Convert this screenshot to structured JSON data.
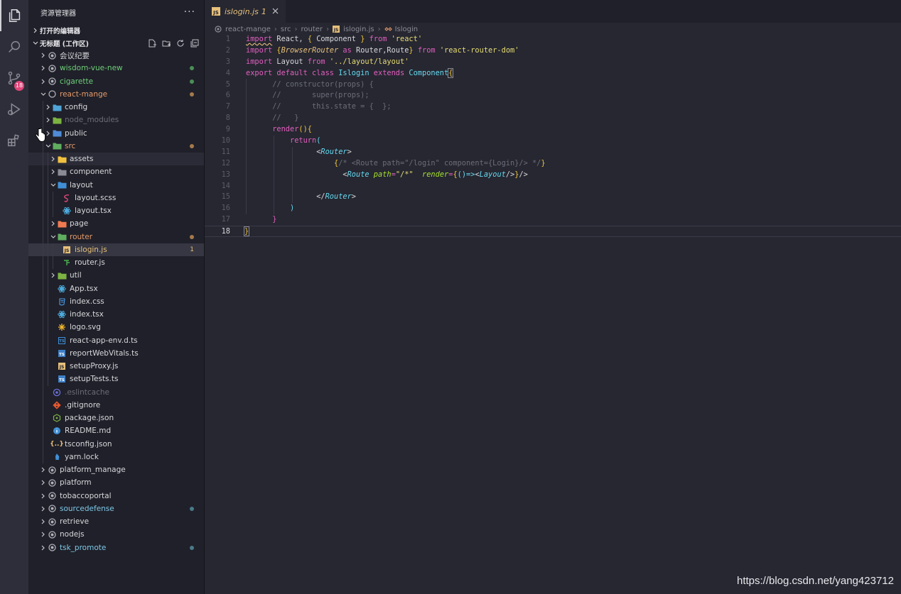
{
  "sidebar": {
    "title": "资源管理器",
    "more": "···",
    "open_editors": "打开的编辑器",
    "workspace": "无标题 (工作区)"
  },
  "activity": {
    "scm_badge": "18"
  },
  "tree": [
    {
      "label": "会议纪要",
      "indent": 0,
      "chev": ">",
      "icon": "folder-root-icon",
      "color": "#d8d8dc"
    },
    {
      "label": "wisdom-vue-new",
      "indent": 0,
      "chev": ">",
      "icon": "folder-root-icon",
      "color": "#6fce7a",
      "dot": "#4a8f57"
    },
    {
      "label": "cigarette",
      "indent": 0,
      "chev": ">",
      "icon": "folder-root-icon",
      "color": "#6fce7a",
      "dot": "#4a8f57"
    },
    {
      "label": "react-mange",
      "indent": 0,
      "chev": "v",
      "icon": "folder-root-open-icon",
      "color": "#e59a6a",
      "dot": "#a57a4a"
    },
    {
      "label": "config",
      "indent": 1,
      "chev": ">",
      "icon": "folder-config-icon",
      "color": "#d8d8dc"
    },
    {
      "label": "node_modules",
      "indent": 1,
      "chev": ">",
      "icon": "folder-node-icon",
      "color": "#6c6d78"
    },
    {
      "label": "public",
      "indent": 1,
      "chev": ">",
      "icon": "folder-public-icon",
      "color": "#d8d8dc"
    },
    {
      "label": "src",
      "indent": 1,
      "chev": "v",
      "icon": "folder-src-icon",
      "color": "#e59a6a",
      "dot": "#a57a4a"
    },
    {
      "label": "assets",
      "indent": 2,
      "chev": ">",
      "icon": "folder-assets-icon",
      "color": "#d8d8dc",
      "hl": true
    },
    {
      "label": "component",
      "indent": 2,
      "chev": ">",
      "icon": "folder-icon",
      "color": "#d8d8dc"
    },
    {
      "label": "layout",
      "indent": 2,
      "chev": "v",
      "icon": "folder-layout-icon",
      "color": "#d8d8dc"
    },
    {
      "label": "layout.scss",
      "indent": 3,
      "chev": "",
      "icon": "sass-icon",
      "color": "#d8d8dc"
    },
    {
      "label": "layout.tsx",
      "indent": 3,
      "chev": "",
      "icon": "react-icon",
      "color": "#d8d8dc"
    },
    {
      "label": "page",
      "indent": 2,
      "chev": ">",
      "icon": "folder-page-icon",
      "color": "#d8d8dc"
    },
    {
      "label": "router",
      "indent": 2,
      "chev": "v",
      "icon": "folder-router-icon",
      "color": "#e59a6a",
      "dot": "#a57a4a"
    },
    {
      "label": "islogin.js",
      "indent": 3,
      "chev": "",
      "icon": "js-icon",
      "color": "#e7c07b",
      "num": "1",
      "selected": true
    },
    {
      "label": "router.js",
      "indent": 3,
      "chev": "",
      "icon": "routing-icon",
      "color": "#d8d8dc"
    },
    {
      "label": "util",
      "indent": 2,
      "chev": ">",
      "icon": "folder-util-icon",
      "color": "#d8d8dc"
    },
    {
      "label": "App.tsx",
      "indent": 2,
      "chev": "",
      "icon": "react-icon",
      "color": "#d8d8dc"
    },
    {
      "label": "index.css",
      "indent": 2,
      "chev": "",
      "icon": "css-icon",
      "color": "#d8d8dc"
    },
    {
      "label": "index.tsx",
      "indent": 2,
      "chev": "",
      "icon": "react-icon",
      "color": "#d8d8dc"
    },
    {
      "label": "logo.svg",
      "indent": 2,
      "chev": "",
      "icon": "svg-icon",
      "color": "#d8d8dc"
    },
    {
      "label": "react-app-env.d.ts",
      "indent": 2,
      "chev": "",
      "icon": "ts-def-icon",
      "color": "#d8d8dc"
    },
    {
      "label": "reportWebVitals.ts",
      "indent": 2,
      "chev": "",
      "icon": "ts-icon",
      "color": "#d8d8dc"
    },
    {
      "label": "setupProxy.js",
      "indent": 2,
      "chev": "",
      "icon": "js-icon",
      "color": "#d8d8dc"
    },
    {
      "label": "setupTests.ts",
      "indent": 2,
      "chev": "",
      "icon": "ts-icon",
      "color": "#d8d8dc"
    },
    {
      "label": ".eslintcache",
      "indent": 1,
      "chev": "",
      "icon": "eslint-icon",
      "color": "#6c6d78"
    },
    {
      "label": ".gitignore",
      "indent": 1,
      "chev": "",
      "icon": "git-icon",
      "color": "#d8d8dc"
    },
    {
      "label": "package.json",
      "indent": 1,
      "chev": "",
      "icon": "nodejs-icon",
      "color": "#d8d8dc"
    },
    {
      "label": "README.md",
      "indent": 1,
      "chev": "",
      "icon": "info-icon",
      "color": "#d8d8dc"
    },
    {
      "label": "tsconfig.json",
      "indent": 1,
      "chev": "",
      "icon": "json-icon",
      "color": "#d8d8dc"
    },
    {
      "label": "yarn.lock",
      "indent": 1,
      "chev": "",
      "icon": "yarn-icon",
      "color": "#d8d8dc"
    },
    {
      "label": "platform_manage",
      "indent": 0,
      "chev": ">",
      "icon": "folder-root-icon",
      "color": "#d8d8dc"
    },
    {
      "label": "platform",
      "indent": 0,
      "chev": ">",
      "icon": "folder-root-icon",
      "color": "#d8d8dc"
    },
    {
      "label": "tobaccoportal",
      "indent": 0,
      "chev": ">",
      "icon": "folder-root-icon",
      "color": "#d8d8dc"
    },
    {
      "label": "sourcedefense",
      "indent": 0,
      "chev": ">",
      "icon": "folder-root-icon",
      "color": "#7fc8e8",
      "dot": "#4a7a8a"
    },
    {
      "label": "retrieve",
      "indent": 0,
      "chev": ">",
      "icon": "folder-root-icon",
      "color": "#d8d8dc"
    },
    {
      "label": "nodejs",
      "indent": 0,
      "chev": ">",
      "icon": "folder-root-icon",
      "color": "#d8d8dc"
    },
    {
      "label": "tsk_promote",
      "indent": 0,
      "chev": ">",
      "icon": "folder-root-icon",
      "color": "#7fc8e8",
      "dot": "#4a7a8a"
    }
  ],
  "editor": {
    "tab_label": "islogin.js",
    "tab_problems": "1",
    "breadcrumbs": [
      "react-mange",
      "src",
      "router",
      "islogin.js",
      "Islogin"
    ],
    "line_numbers": [
      "1",
      "2",
      "3",
      "4",
      "5",
      "6",
      "7",
      "8",
      "9",
      "10",
      "11",
      "12",
      "13",
      "14",
      "15",
      "16",
      "17",
      "18"
    ],
    "current_line": "18"
  },
  "watermark": "https://blog.csdn.net/yang423712"
}
